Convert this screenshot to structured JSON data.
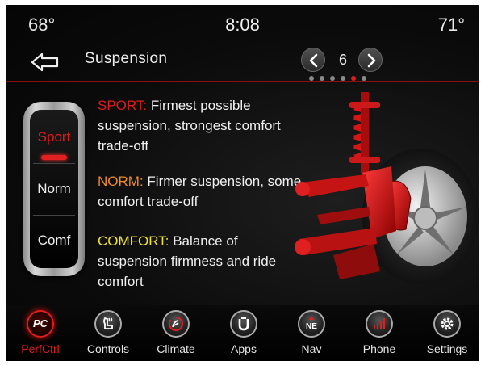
{
  "status": {
    "outside_temp_left": "68°",
    "clock": "8:08",
    "outside_temp_right": "71°"
  },
  "header": {
    "title": "Suspension",
    "page_number": "6",
    "page_dots_total": 6,
    "page_dots_active": 4
  },
  "modes": [
    {
      "label": "Sport",
      "selected": true
    },
    {
      "label": "Norm",
      "selected": false
    },
    {
      "label": "Comf",
      "selected": false
    }
  ],
  "descriptions": {
    "sport": {
      "label": "SPORT:",
      "text": "Firmest possible suspension, strongest comfort trade-off"
    },
    "norm": {
      "label": "NORM:",
      "text": "Firmer suspension, some comfort trade-off"
    },
    "comfort": {
      "label": "COMFORT:",
      "text": "Balance of suspension firmness and ride comfort"
    }
  },
  "dock": [
    {
      "id": "perfctrl",
      "label": "PerfCtrl",
      "icon": "pc-icon",
      "active": true
    },
    {
      "id": "controls",
      "label": "Controls",
      "icon": "seat-heat-icon"
    },
    {
      "id": "climate",
      "label": "Climate",
      "icon": "climate-icon"
    },
    {
      "id": "apps",
      "label": "Apps",
      "icon": "apps-icon"
    },
    {
      "id": "nav",
      "label": "Nav",
      "icon": "compass-icon",
      "glyph": "NE"
    },
    {
      "id": "phone",
      "label": "Phone",
      "icon": "phone-signal-icon"
    },
    {
      "id": "settings",
      "label": "Settings",
      "icon": "gear-icon"
    }
  ],
  "colors": {
    "accent_red": "#e01d1d",
    "norm_orange": "#f08a2a",
    "comfort_yellow": "#f0e233"
  }
}
